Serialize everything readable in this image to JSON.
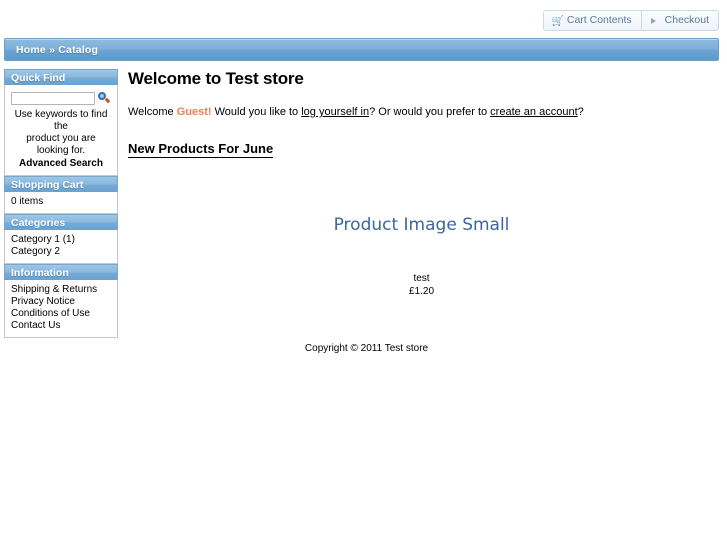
{
  "header": {
    "buttons": [
      {
        "label": "Cart Contents",
        "icon": "shopping-cart-icon"
      },
      {
        "label": "Checkout",
        "icon": "arrow-right-icon"
      }
    ]
  },
  "breadcrumb": {
    "text": "Home » Catalog"
  },
  "sidebar": {
    "boxes": [
      {
        "id": "quick-find",
        "title": "Quick Find",
        "search_value": "",
        "search_placeholder": "",
        "note_line1": "Use keywords to find the",
        "note_line2": "product you are looking for.",
        "advanced_search": "Advanced Search"
      },
      {
        "id": "shopping-cart",
        "title": "Shopping Cart",
        "items": [
          "0 items"
        ]
      },
      {
        "id": "categories",
        "title": "Categories",
        "items": [
          "Category 1 (1)",
          "Category 2"
        ]
      },
      {
        "id": "information",
        "title": "Information",
        "items": [
          "Shipping & Returns",
          "Privacy Notice",
          "Conditions of Use",
          "Contact Us"
        ]
      }
    ]
  },
  "main": {
    "page_title": "Welcome to Test store",
    "welcome": {
      "prefix": "Welcome ",
      "guest": "Guest!",
      "mid1": " Would you like to ",
      "link1": "log yourself in",
      "mid2": "? Or would you prefer to ",
      "link2": "create an account",
      "suffix": "?"
    },
    "section_title": "New Products For June",
    "products": [
      {
        "image_alt": "Product Image Small",
        "name": "test",
        "price": "£1.20"
      }
    ]
  },
  "footer": {
    "copyright": "Copyright © 2011 Test store"
  },
  "colors": {
    "accent_blue": "#6ba3d0",
    "link_blue": "#3a66a0",
    "guest_orange": "#f07f50",
    "button_text": "#5b7b9c"
  }
}
